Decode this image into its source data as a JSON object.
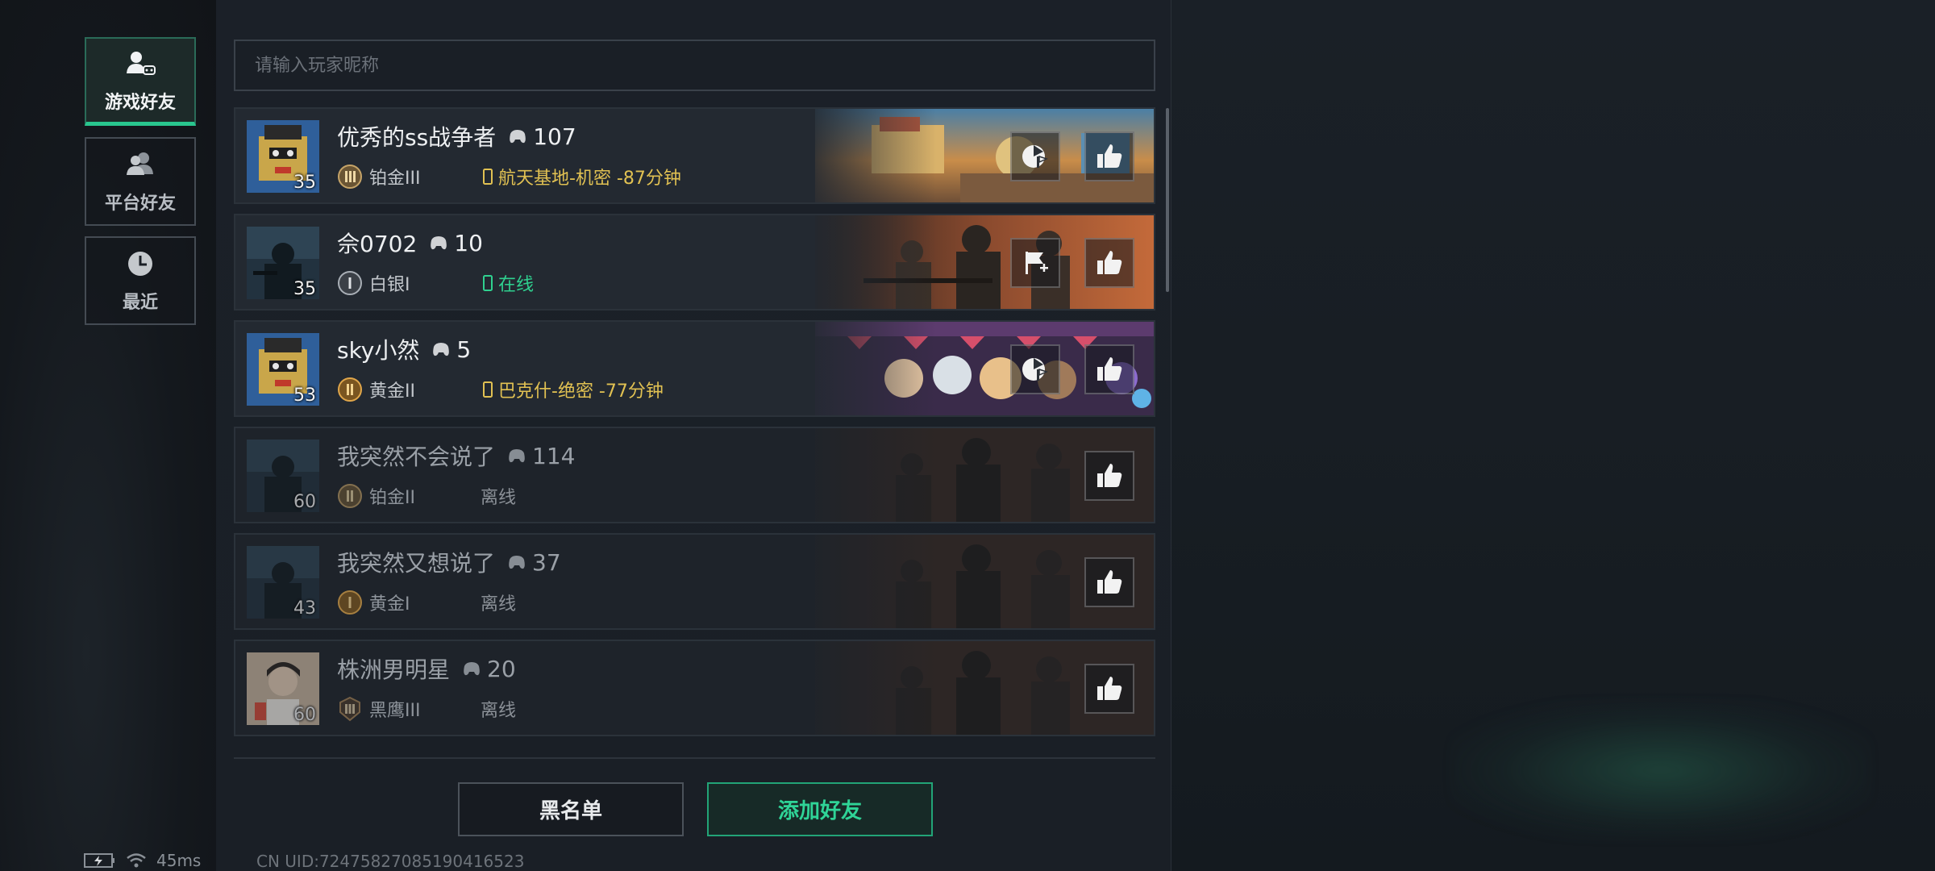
{
  "sidebar": {
    "tabs": [
      {
        "label": "游戏好友",
        "icon": "game-friends-icon",
        "active": true
      },
      {
        "label": "平台好友",
        "icon": "platform-friends-icon",
        "active": false
      },
      {
        "label": "最近",
        "icon": "clock-icon",
        "active": false
      }
    ]
  },
  "search": {
    "placeholder": "请输入玩家昵称",
    "value": ""
  },
  "friends": [
    {
      "name": "优秀的ss战争者",
      "games": "107",
      "level": "35",
      "rank": "铂金III",
      "status": "航天基地-机密 -87分钟",
      "status_type": "in-game",
      "invite": true
    },
    {
      "name": "佘0702",
      "games": "10",
      "level": "35",
      "rank": "白银I",
      "status": "在线",
      "status_type": "online",
      "invite": true
    },
    {
      "name": "sky小然",
      "games": "5",
      "level": "53",
      "rank": "黄金II",
      "status": "巴克什-绝密 -77分钟",
      "status_type": "in-game",
      "invite": true
    },
    {
      "name": "我突然不会说了",
      "games": "114",
      "level": "60",
      "rank": "铂金II",
      "status": "离线",
      "status_type": "offline",
      "invite": false
    },
    {
      "name": "我突然又想说了",
      "games": "37",
      "level": "43",
      "rank": "黄金I",
      "status": "离线",
      "status_type": "offline",
      "invite": false
    },
    {
      "name": "株洲男明星",
      "games": "20",
      "level": "60",
      "rank": "黑鹰III",
      "status": "离线",
      "status_type": "offline",
      "invite": false
    }
  ],
  "buttons": {
    "blacklist": "黑名单",
    "add_friend": "添加好友"
  },
  "footer": {
    "ping": "45ms",
    "uid": "CN UID:7247582708519041​6523"
  },
  "colors": {
    "accent_green": "#2fd497",
    "in_game_yellow": "#e1c152",
    "online_green": "#2fd08f"
  }
}
